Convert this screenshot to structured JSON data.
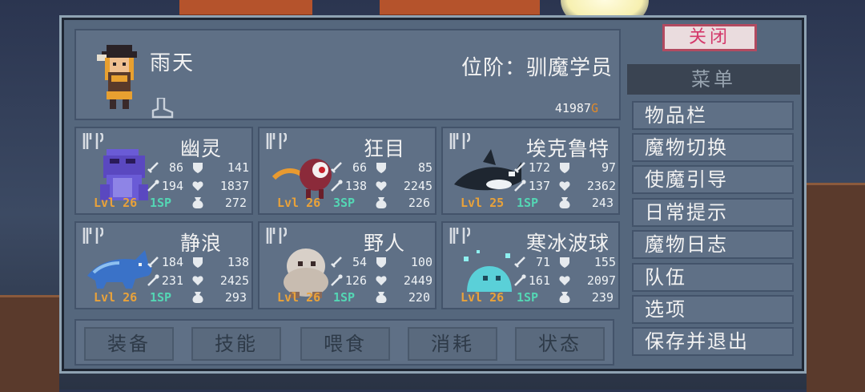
{
  "header": {
    "player_name": "雨天",
    "rank": "位阶：驯魔学员",
    "gold_amount": "41987",
    "gold_unit": "G"
  },
  "monsters": [
    {
      "name": "幽灵",
      "atk": "86",
      "def": "141",
      "mag": "194",
      "hp": "1837",
      "level": "Lvl 26",
      "sp": "1SP",
      "stat3": "272",
      "color": "#6a5bd6"
    },
    {
      "name": "狂目",
      "atk": "66",
      "def": "85",
      "mag": "138",
      "hp": "2245",
      "level": "Lvl 26",
      "sp": "3SP",
      "stat3": "226",
      "color": "#8b2a3a"
    },
    {
      "name": "埃克鲁特",
      "atk": "172",
      "def": "97",
      "mag": "137",
      "hp": "2362",
      "level": "Lvl 25",
      "sp": "1SP",
      "stat3": "243",
      "color": "#1e2630"
    },
    {
      "name": "静浪",
      "atk": "184",
      "def": "138",
      "mag": "231",
      "hp": "2425",
      "level": "Lvl 26",
      "sp": "1SP",
      "stat3": "293",
      "color": "#3a72c8"
    },
    {
      "name": "野人",
      "atk": "54",
      "def": "100",
      "mag": "126",
      "hp": "2449",
      "level": "Lvl 26",
      "sp": "1SP",
      "stat3": "220",
      "color": "#d8d0c8"
    },
    {
      "name": "寒冰波球",
      "atk": "71",
      "def": "155",
      "mag": "161",
      "hp": "2097",
      "level": "Lvl 26",
      "sp": "1SP",
      "stat3": "239",
      "color": "#5ad0d8"
    }
  ],
  "tabs": [
    "装备",
    "技能",
    "喂食",
    "消耗",
    "状态"
  ],
  "menu": {
    "close_label": "关闭",
    "title": "菜单",
    "items": [
      "物品栏",
      "魔物切换",
      "使魔引导",
      "日常提示",
      "魔物日志",
      "队伍",
      "选项",
      "保存并退出"
    ]
  }
}
